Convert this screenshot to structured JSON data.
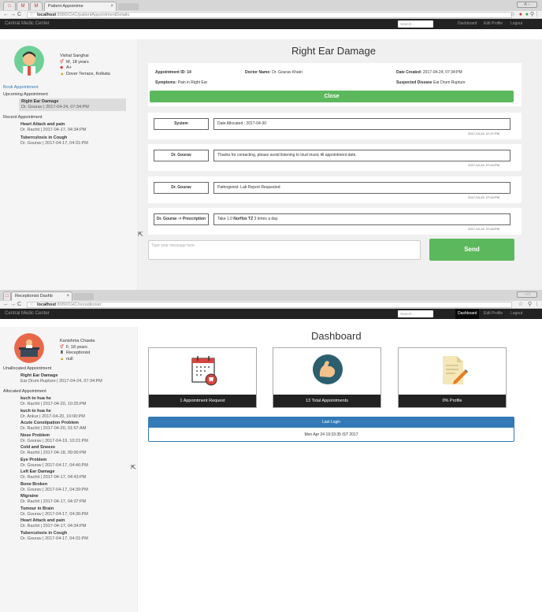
{
  "screen1": {
    "browser": {
      "tab_title": "Patient Appointme",
      "url_host": "localhost",
      "url_path": ":8080/CHC/patientAppointmentDetails"
    },
    "nav": {
      "brand": "Central Medic Center",
      "search_placeholder": "Search...",
      "links": [
        "Dashboard",
        "Edit Profile",
        "Logout"
      ]
    },
    "profile": {
      "name": "Vishal Sanghai",
      "gender_age": "M, 18 years",
      "blood": "A+",
      "address": "Dover Terrace, Kolkata"
    },
    "sidebar": {
      "book_link": "Book Appointment",
      "upcoming_heading": "Upcoming Appointment",
      "upcoming": [
        {
          "title": "Right Ear Damage",
          "sub": "Dr. Gourav | 2017-04-24, 07:34:PM"
        }
      ],
      "recent_heading": "Recent Appointment",
      "recent": [
        {
          "title": "Heart Attack and pain",
          "sub": "Dr. Rachit | 2017-04-17, 04:34:PM"
        },
        {
          "title": "Tuberculosis in Cough",
          "sub": "Dr. Gourav | 2017-04-17, 04:31:PM"
        }
      ]
    },
    "appointment": {
      "title": "Right Ear Damage",
      "id_label": "Appointment ID:",
      "id": "14",
      "doctor_label": "Doctor Name:",
      "doctor": "Dr. Gourav Khatri",
      "created_label": "Date Created:",
      "created": "2017-04-24, 07:34:PM",
      "symptoms_label": "Symptoms:",
      "symptoms": "Pain in Right Ear",
      "disease_label": "Suspected Disease",
      "disease": "Ear Drum Rupture",
      "close_label": "Close"
    },
    "messages": [
      {
        "who": "System",
        "text": "Date Allocated : 2017-04-30",
        "time": "2017-04-24, 07:37:PM"
      },
      {
        "who": "Dr. Gourav",
        "text": "Thanks for contacting, please avoid listening to loud music till appointment date.",
        "time": "2017-04-24, 07:44:PM"
      },
      {
        "who": "Dr. Gourav",
        "text": "Pathogenist: Lab Report Requested",
        "time": "2017-04-24, 07:44:PM"
      },
      {
        "who": "Dr. Gourav -> Prescription",
        "text_pre": "Take 1.0 ",
        "text_bold": "Norflox TZ",
        "text_post": " 3 times a day.",
        "time": "2017-04-24, 07:45:PM"
      }
    ],
    "compose": {
      "placeholder": "Type your message here",
      "send_label": "Send"
    }
  },
  "screen2": {
    "browser": {
      "tab_title": "Receptionist Dashb",
      "url_host": "localhost",
      "url_path": ":8080/CHC/receptionist"
    },
    "nav": {
      "brand": "Central Medic Center",
      "search_placeholder": "Search...",
      "links": [
        "Dashboard",
        "Edit Profile",
        "Logout"
      ]
    },
    "profile": {
      "name": "Kanishma Chawla",
      "gender_age": "F, 18 years",
      "role": "Receptionist",
      "address": "null"
    },
    "sidebar": {
      "unallocated_heading": "Unallocated Appointment",
      "unallocated": [
        {
          "title": "Right Ear Damage",
          "sub": "Ear Drum Rupture | 2017-04-24, 07:34:PM"
        }
      ],
      "allocated_heading": "Allocated Appointment",
      "allocated": [
        {
          "title": "kuch to hua he",
          "sub": "Dr. Rachit | 2017-04-20, 10:25:PM"
        },
        {
          "title": "kuch to hua he",
          "sub": "Dr. Ankur | 2017-04-20, 10:00:PM"
        },
        {
          "title": "Acute Constipation Problem",
          "sub": "Dr. Rachit | 2017-04-20, 01:57:AM"
        },
        {
          "title": "Nose Problem",
          "sub": "Dr. Gourav | 2017-04-19, 10:21:PM"
        },
        {
          "title": "Cold and Sneeze",
          "sub": "Dr. Rachit | 2017-04-18, 09:00:PM"
        },
        {
          "title": "Eye Problem",
          "sub": "Dr. Gourav | 2017-04-17, 04:46:PM"
        },
        {
          "title": "Left Ear Damage",
          "sub": "Dr. Rachit | 2017-04-17, 04:43:PM"
        },
        {
          "title": "Bone Broken",
          "sub": "Dr. Gourav | 2017-04-17, 04:39:PM"
        },
        {
          "title": "Migraine",
          "sub": "Dr. Rachit | 2017-04-17, 04:37:PM"
        },
        {
          "title": "Tumour in Brain",
          "sub": "Dr. Gourav | 2017-04-17, 04:36:PM"
        },
        {
          "title": "Heart Attack and pain",
          "sub": "Dr. Rachit | 2017-04-17, 04:34:PM"
        },
        {
          "title": "Tuberculosis in Cough",
          "sub": "Dr. Gourav | 2017-04-17, 04:31:PM"
        }
      ]
    },
    "dashboard": {
      "title": "Dashboard",
      "cards": [
        "1 Appointment Request",
        "13 Total Appointments",
        "0% Profile"
      ],
      "last_login_label": "Last Login",
      "last_login": "Mon Apr 24 19:33:35 IST 2017"
    }
  }
}
